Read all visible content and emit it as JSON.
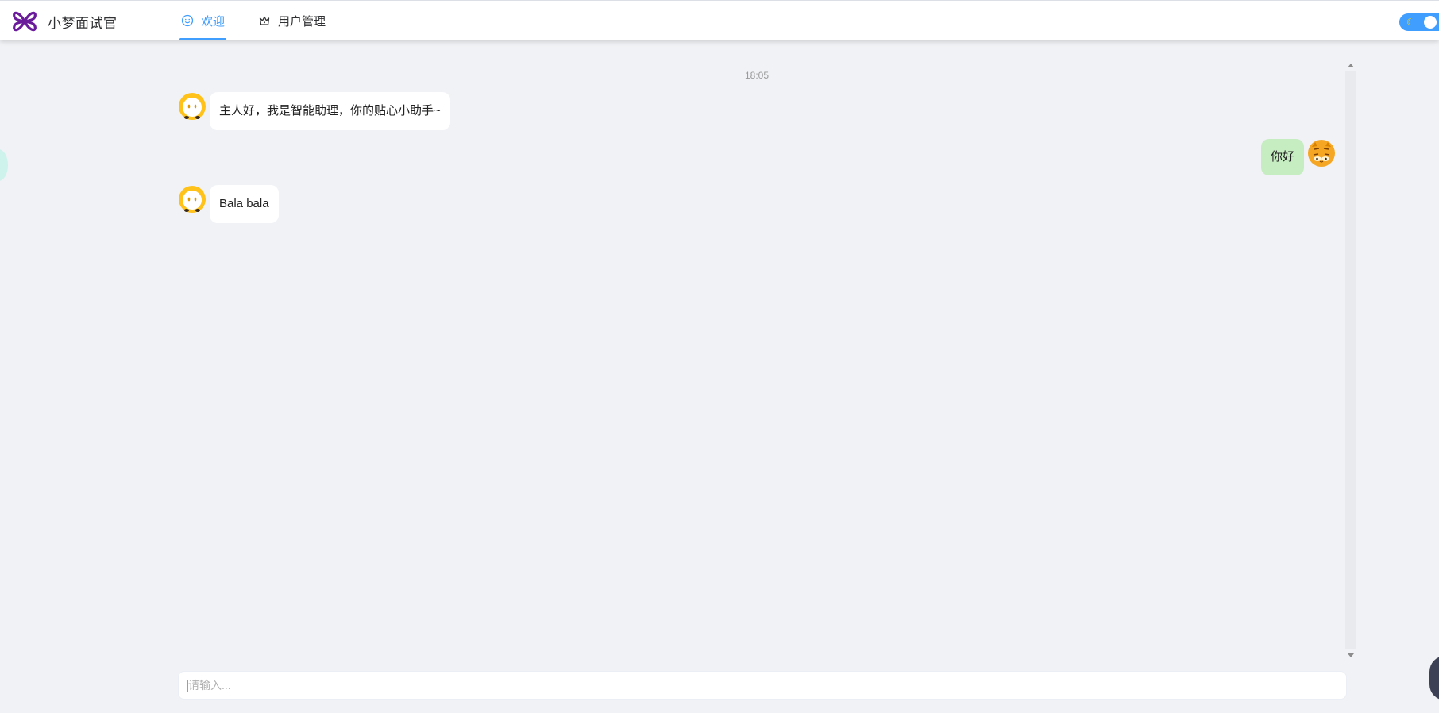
{
  "header": {
    "brand_name": "小梦面试官",
    "nav": [
      {
        "label": "欢迎",
        "icon": "smile-icon",
        "active": true
      },
      {
        "label": "用户管理",
        "icon": "crown-icon",
        "active": false
      }
    ],
    "theme_toggle": {
      "mode": "dark",
      "icon": "moon-icon",
      "on": true
    }
  },
  "chat": {
    "timestamp": "18:05",
    "messages": [
      {
        "side": "left",
        "avatar": "robot-avatar",
        "text": "主人好，我是智能助理，你的贴心小助手~"
      },
      {
        "side": "right",
        "avatar": "cat-avatar",
        "text": "你好"
      },
      {
        "side": "left",
        "avatar": "robot-avatar",
        "text": "Bala bala"
      }
    ]
  },
  "input": {
    "placeholder": "请输入...",
    "value": ""
  },
  "colors": {
    "accent": "#409eff",
    "background": "#f0f2f5",
    "user_bubble": "#c6edc1",
    "bot_bubble": "#ffffff",
    "brand_purple": "#6a1b9a"
  }
}
